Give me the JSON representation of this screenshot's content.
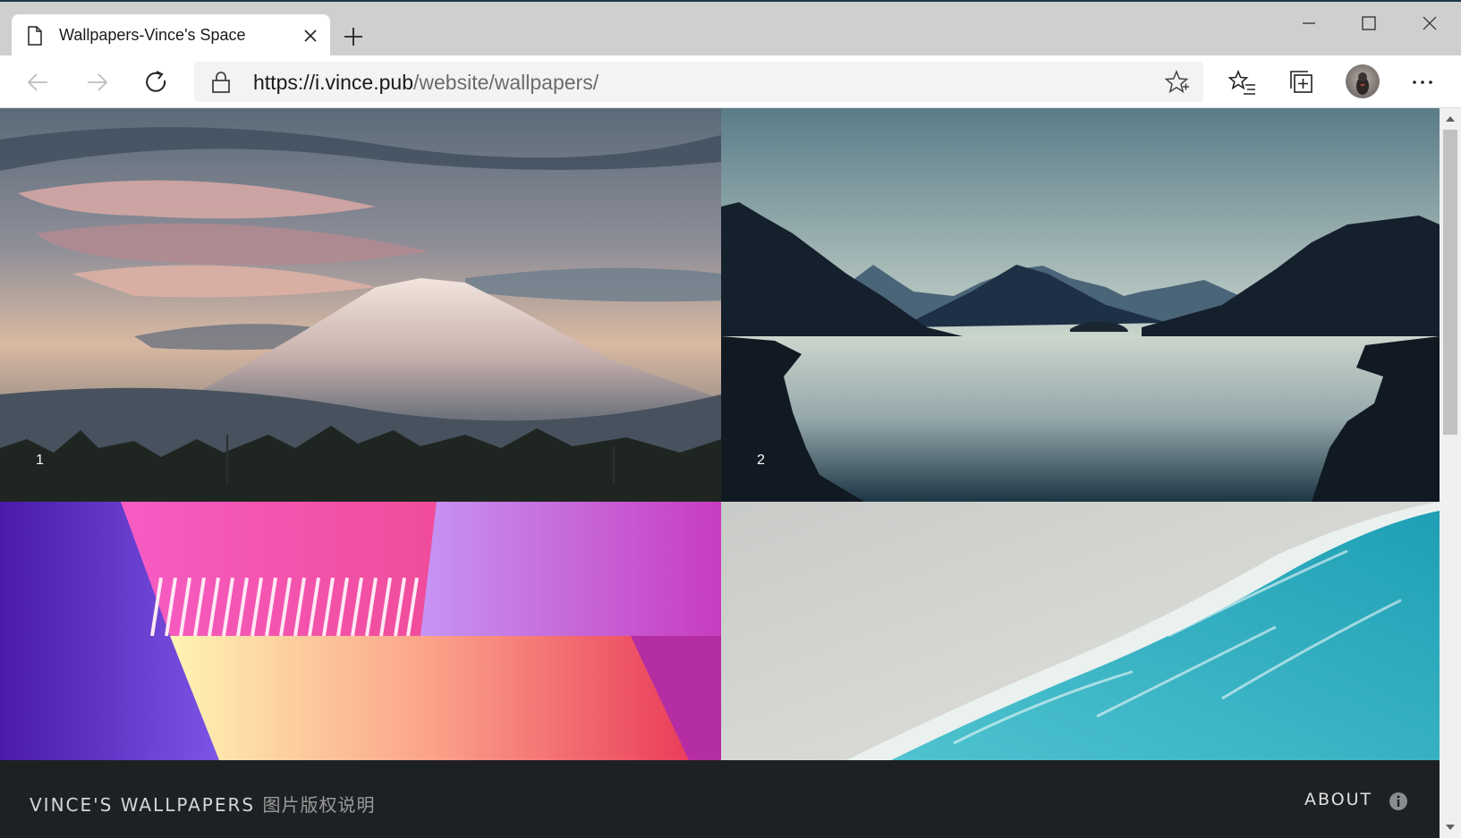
{
  "browser": {
    "tab_title": "Wallpapers-Vince's Space",
    "url_host": "https://i.vince.pub",
    "url_path": "/website/wallpapers/",
    "icons": {
      "tab": "page-icon",
      "close": "close-icon",
      "new_tab": "plus-icon",
      "back": "arrow-left-icon",
      "forward": "arrow-right-icon",
      "refresh": "refresh-icon",
      "lock": "lock-icon",
      "favorite": "star-add-icon",
      "favorites": "favorites-icon",
      "collections": "collections-icon",
      "profile": "avatar",
      "more": "more-icon"
    }
  },
  "gallery": {
    "tiles": [
      {
        "number": "1",
        "subject": "snow-capped mountain at sunset"
      },
      {
        "number": "2",
        "subject": "minimal mountain lake"
      },
      {
        "number": "",
        "subject": "neon gradient architecture"
      },
      {
        "number": "",
        "subject": "turquoise ocean shoreline"
      }
    ]
  },
  "footer": {
    "site_title": "VINCE'S WALLPAPERS",
    "copyright_link": "图片版权说明",
    "about_label": "ABOUT",
    "info_icon": "info-icon"
  },
  "colors": {
    "footer_bg": "#1e2124",
    "titlebar_bg": "#cfcfcf"
  }
}
